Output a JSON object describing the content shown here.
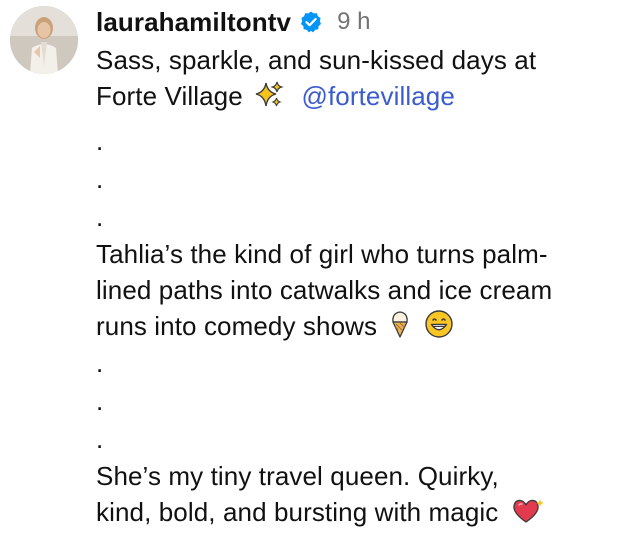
{
  "post": {
    "username": "laurahamiltontv",
    "time": "9 h",
    "caption": {
      "line1": "Sass, sparkle, and sun-kissed days at",
      "line2_text": "Forte Village",
      "line2_mention": "@fortevillage",
      "dot": ".",
      "para2": [
        "Tahlia’s the kind of girl who turns palm-",
        "lined paths into catwalks and ice cream",
        "runs into comedy shows"
      ],
      "para3": [
        "She’s my tiny travel queen. Quirky,",
        "kind, bold, and bursting with magic"
      ]
    },
    "icons": {
      "verified": "verified-badge-icon",
      "sparkles": "sparkles-emoji-icon",
      "ice_cream": "ice-cream-emoji-icon",
      "grin": "grinning-face-emoji-icon",
      "heart": "sparkling-heart-emoji-icon"
    },
    "colors": {
      "text": "#111111",
      "muted": "#737373",
      "mention": "#3b5ccf",
      "verified": "#0095f6"
    }
  }
}
